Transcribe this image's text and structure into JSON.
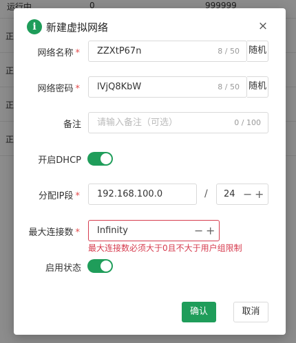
{
  "background": {
    "top_row": {
      "status": "运行中",
      "col2": "0",
      "col3": "999999"
    },
    "edge_chars": [
      "正",
      "正",
      "正",
      "正"
    ]
  },
  "dialog": {
    "title": "新建虚拟网络",
    "info_icon": "i",
    "close_icon": "×",
    "network_name": {
      "label": "网络名称",
      "value": "ZZXtP67n",
      "count": "8 / 50",
      "suffix": "随机"
    },
    "network_password": {
      "label": "网络密码",
      "value": "lVjQ8KbW",
      "count": "8 / 50",
      "suffix": "随机"
    },
    "remark": {
      "label": "备注",
      "placeholder": "请输入备注（可选）",
      "count": "0 / 100"
    },
    "dhcp": {
      "label": "开启DHCP",
      "enabled": true
    },
    "ip_segment": {
      "label": "分配IP段",
      "ip": "192.168.100.0",
      "separator": "/",
      "mask": "24",
      "minus": "−",
      "plus": "+"
    },
    "max_connections": {
      "label": "最大连接数",
      "value": "Infinity",
      "minus": "−",
      "plus": "+",
      "error": "最大连接数必须大于0且不大于用户组限制"
    },
    "enable_status": {
      "label": "启用状态",
      "enabled": true
    },
    "required_mark": "*",
    "confirm_label": "确认",
    "cancel_label": "取消"
  },
  "colors": {
    "accent": "#1f9d5a",
    "error": "#d63b4e",
    "required": "#e34a4a"
  }
}
